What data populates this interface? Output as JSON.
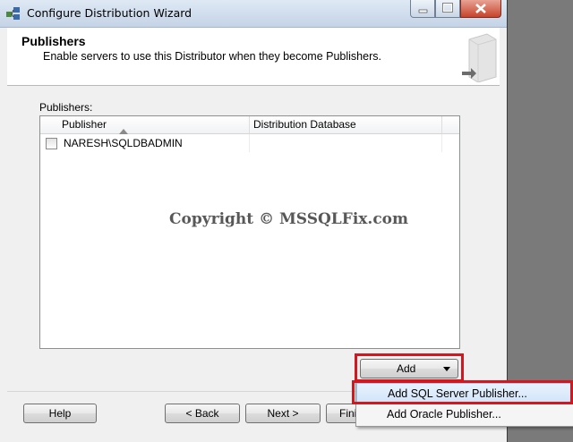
{
  "window": {
    "title": "Configure Distribution Wizard",
    "icon": "wizard-icon"
  },
  "header": {
    "title": "Publishers",
    "subtitle": "Enable servers to use this Distributor when they become Publishers."
  },
  "publishers": {
    "label": "Publishers:",
    "columns": [
      "Publisher",
      "Distribution Database"
    ],
    "sort_column": "Publisher",
    "sort_direction": "ascending",
    "rows": [
      {
        "publisher": "NARESH\\SQLDBADMIN",
        "distribution_database": "",
        "checked": false
      }
    ]
  },
  "watermark": "Copyright ©  MSSQLFix.com",
  "add_button": {
    "label": "Add",
    "icon": "dropdown-arrow-icon"
  },
  "add_menu": {
    "items": [
      "Add SQL Server Publisher...",
      "Add Oracle Publisher..."
    ],
    "highlighted_index": 0
  },
  "footer": {
    "help": "Help",
    "back": "< Back",
    "next": "Next >",
    "finish_partial": "Fini"
  },
  "colors": {
    "highlight_box": "#d11820",
    "menu_hover": "#d3e5fa"
  }
}
